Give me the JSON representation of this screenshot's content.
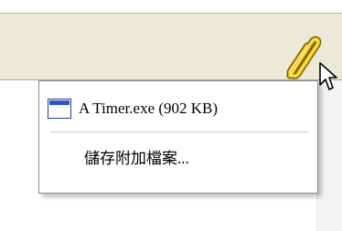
{
  "menu": {
    "items": [
      {
        "label": "A Timer.exe (902 KB)",
        "icon": "application-window-icon"
      },
      {
        "label": "儲存附加檔案..."
      }
    ]
  },
  "toolbar": {
    "attach_icon": "paperclip-icon"
  },
  "colors": {
    "toolbar_bg": "#ece9d8",
    "paperclip": "#e0b000",
    "window_icon_titlebar": "#2856c9"
  }
}
